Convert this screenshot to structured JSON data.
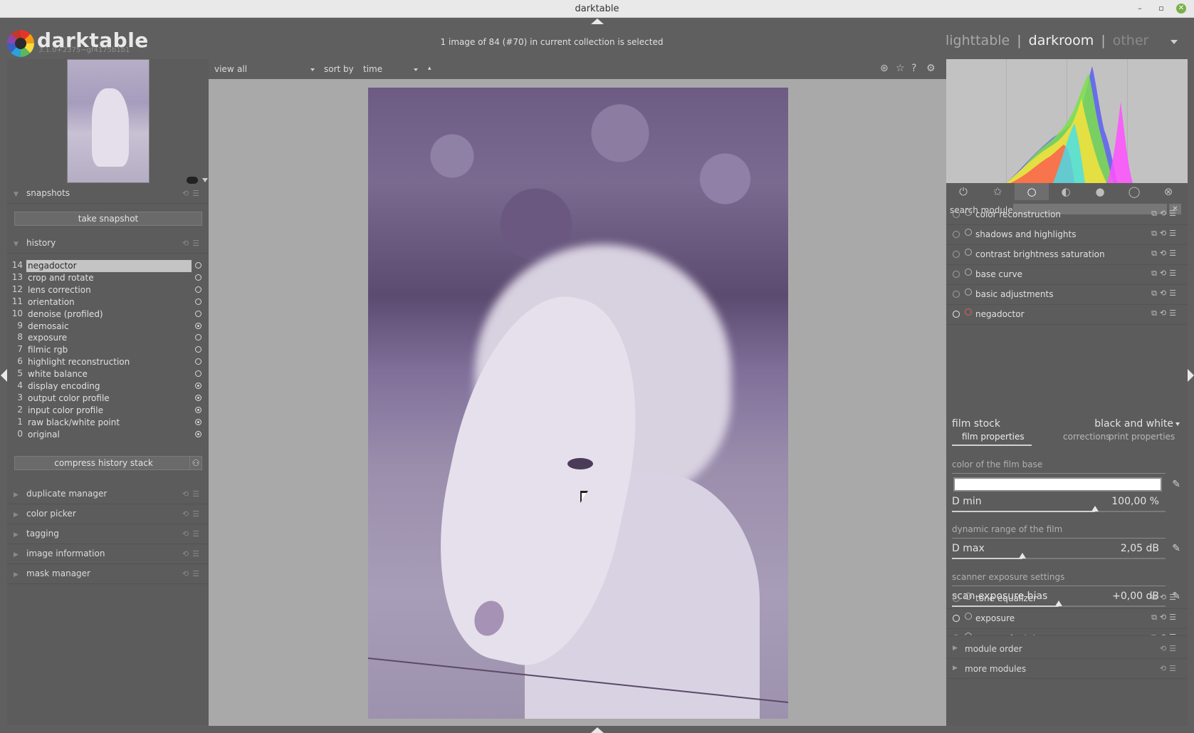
{
  "window": {
    "title": "darktable",
    "minimize": "–",
    "maximize": "▫",
    "close": "✕"
  },
  "header": {
    "app_name": "darktable",
    "version": "3.1.0+2375~gf4175b1b1",
    "selection_info": "1 image of 84 (#70) in current collection is selected",
    "views": {
      "lighttable": "lighttable",
      "sep1": "|",
      "darkroom": "darkroom",
      "sep2": "|",
      "other": "other"
    }
  },
  "left_panel": {
    "snapshots": {
      "label": "snapshots",
      "take_snapshot": "take snapshot"
    },
    "history": {
      "label": "history",
      "items": [
        {
          "num": "14",
          "name": "negadoctor",
          "power": "off"
        },
        {
          "num": "13",
          "name": "crop and rotate",
          "power": "off"
        },
        {
          "num": "12",
          "name": "lens correction",
          "power": "off"
        },
        {
          "num": "11",
          "name": "orientation",
          "power": "off"
        },
        {
          "num": "10",
          "name": "denoise (profiled)",
          "power": "off"
        },
        {
          "num": "9",
          "name": "demosaic",
          "power": "on"
        },
        {
          "num": "8",
          "name": "exposure",
          "power": "off"
        },
        {
          "num": "7",
          "name": "filmic rgb",
          "power": "off"
        },
        {
          "num": "6",
          "name": "highlight reconstruction",
          "power": "off"
        },
        {
          "num": "5",
          "name": "white balance",
          "power": "off"
        },
        {
          "num": "4",
          "name": "display encoding",
          "power": "on"
        },
        {
          "num": "3",
          "name": "output color profile",
          "power": "on"
        },
        {
          "num": "2",
          "name": "input color profile",
          "power": "on"
        },
        {
          "num": "1",
          "name": "raw black/white point",
          "power": "on"
        },
        {
          "num": "0",
          "name": "original",
          "power": "on"
        }
      ],
      "compress": "compress history stack"
    },
    "collapsed": [
      "duplicate manager",
      "color picker",
      "tagging",
      "image information",
      "mask manager"
    ]
  },
  "center_toolbar": {
    "view_label": "view",
    "view_value": "all",
    "sort_label": "sort by",
    "sort_value": "time",
    "sort_dir": "▴"
  },
  "right_panel": {
    "search": {
      "label": "search module",
      "placeholder": ""
    },
    "modules_top": [
      "color reconstruction",
      "shadows and highlights",
      "contrast brightness saturation",
      "base curve",
      "basic adjustments"
    ],
    "negadoctor": {
      "label": "negadoctor",
      "film_stock_label": "film stock",
      "film_stock_value": "black and white",
      "tabs": [
        "film properties",
        "corrections",
        "print properties"
      ],
      "section_film_base": "color of the film base",
      "dmin_label": "D min",
      "dmin_value": "100,00 %",
      "dmin_fraction": 0.67,
      "section_dynamic": "dynamic range of the film",
      "dmax_label": "D max",
      "dmax_value": "2,05 dB",
      "dmax_fraction": 0.33,
      "section_scanner": "scanner exposure settings",
      "scan_label": "scan exposure bias",
      "scan_value": "+0,00 dB",
      "scan_fraction": 0.5
    },
    "modules_bottom": [
      "tone equalizer",
      "exposure",
      "crop and rotate"
    ],
    "collapsed": [
      "module order",
      "more modules"
    ]
  }
}
